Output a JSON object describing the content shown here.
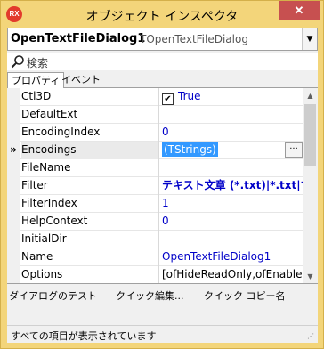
{
  "window": {
    "title": "オブジェクト インスペクタ",
    "app_icon": "RX",
    "close_label": "✕"
  },
  "selector": {
    "component_name": "OpenTextFileDialog1",
    "component_type": "TOpenTextFileDialog",
    "dropdown_icon": "chevron-down-icon"
  },
  "search": {
    "placeholder": "検索"
  },
  "tabs": [
    {
      "label": "プロパティ"
    },
    {
      "label": "イベント"
    }
  ],
  "properties": [
    {
      "name": "Ctl3D",
      "value": "True",
      "checkbox": true
    },
    {
      "name": "DefaultExt",
      "value": ""
    },
    {
      "name": "EncodingIndex",
      "value": "0"
    },
    {
      "name": "Encodings",
      "value": "(TStrings)",
      "selected": true,
      "ellipsis": "···"
    },
    {
      "name": "FileName",
      "value": ""
    },
    {
      "name": "Filter",
      "value": "テキスト文章 (*.txt)|*.txt|す",
      "bold": true
    },
    {
      "name": "FilterIndex",
      "value": "1"
    },
    {
      "name": "HelpContext",
      "value": "0"
    },
    {
      "name": "InitialDir",
      "value": ""
    },
    {
      "name": "Name",
      "value": "OpenTextFileDialog1"
    },
    {
      "name": "Options",
      "value": "[ofHideReadOnly,ofEnableS",
      "black": true
    }
  ],
  "selected_marker": "»",
  "quick_actions": [
    {
      "label": "ダイアログのテスト"
    },
    {
      "label": "クイック編集..."
    },
    {
      "label": "クイック コピー名"
    }
  ],
  "status": {
    "text": "すべての項目が表示されています"
  },
  "colors": {
    "titlebar": "#f3d57a",
    "value_blue": "#0000c8",
    "selection": "#3399ff",
    "close": "#c75050"
  }
}
